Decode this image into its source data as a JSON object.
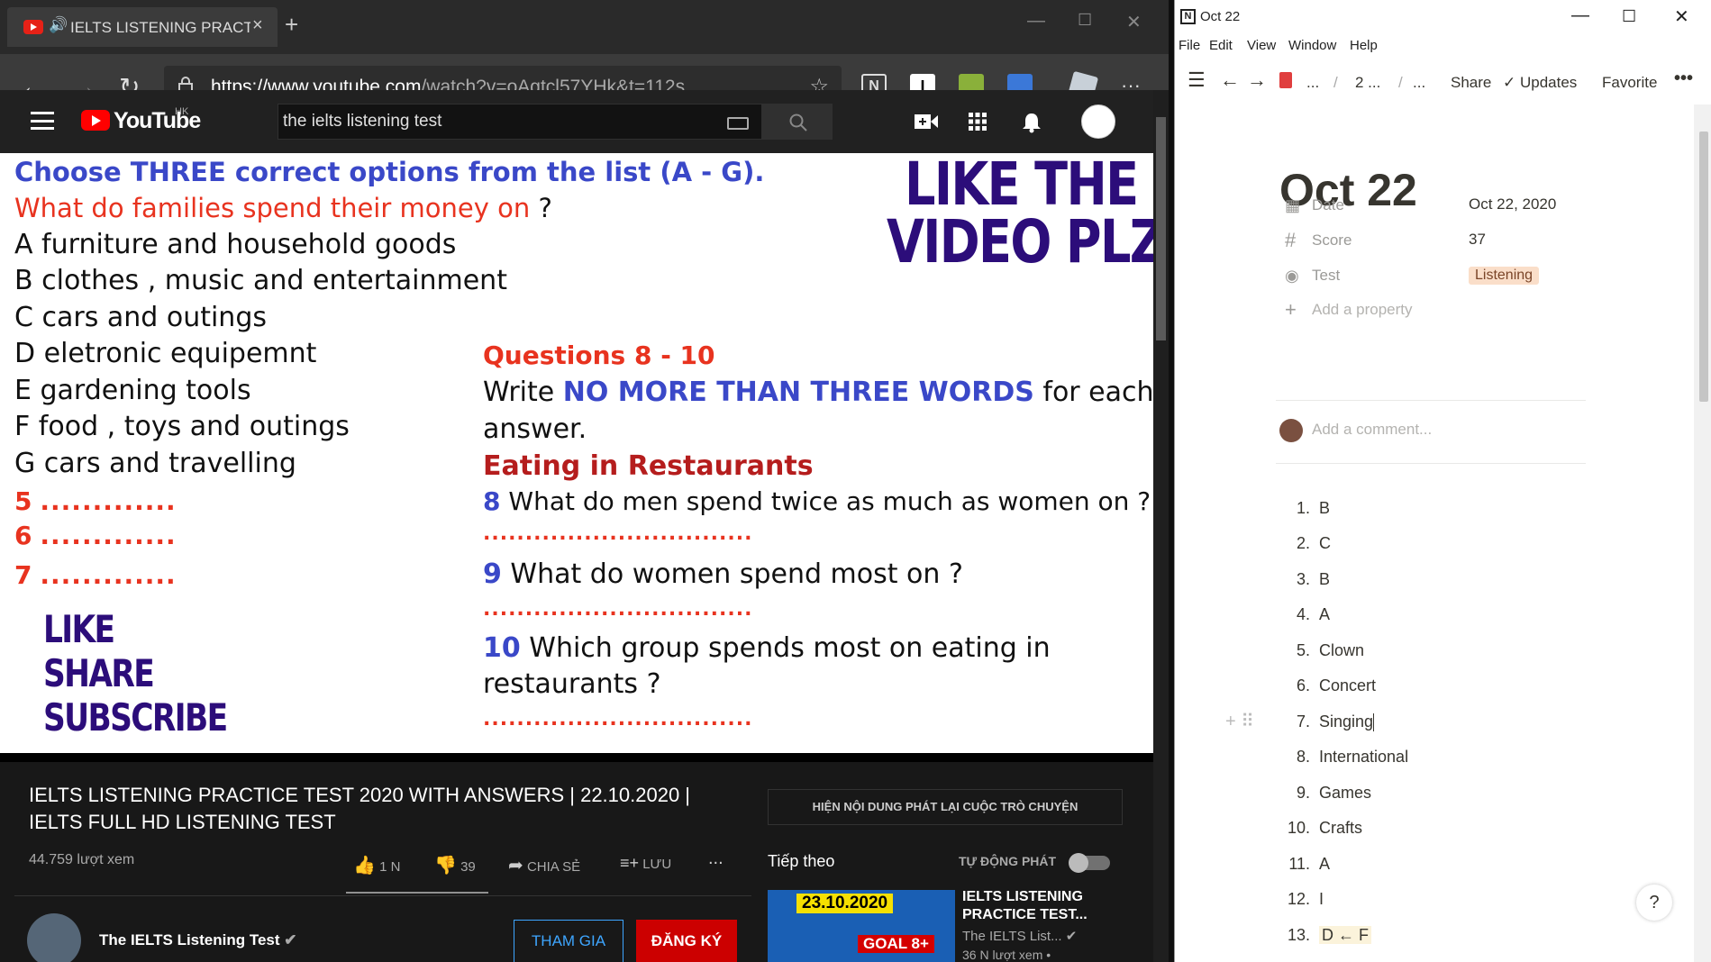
{
  "browser": {
    "tab_title": "IELTS LISTENING PRACTICE",
    "url_host": "https://www.youtube.com",
    "url_path": "/watch?v=oAgtcl57YHk&t=112s",
    "new_tab_icon": "plus-icon",
    "close_tab": "×"
  },
  "youtube": {
    "logo_text": "YouTube",
    "region": "HK",
    "search_query": "the ielts listening test"
  },
  "video": {
    "instr1": "Choose THREE correct options from the list (A - G).",
    "q_red": "What do families spend their money on",
    "q_mark": " ?",
    "options": [
      "A  furniture and household goods",
      "B  clothes , music and entertainment",
      "C  cars and outings",
      "D  eletronic equipemnt",
      "E  gardening tools",
      "F  food , toys and outings",
      "G  cars and travelling"
    ],
    "blank_labels": [
      "5",
      "6",
      "7"
    ],
    "blank_dots": ".............",
    "like_video": [
      "LIKE THE",
      "VIDEO PLZ"
    ],
    "like_share": [
      "LIKE",
      "SHARE",
      "SUBSCRIBE"
    ],
    "q_header": "Questions 8 - 10",
    "write_a": "Write ",
    "write_b": "NO MORE THAN THREE WORDS",
    "write_c": " for each",
    "write_d": "answer.",
    "eating": "Eating in Restaurants",
    "q8_num": "8",
    "q8": " What do men spend twice as much as women on ?",
    "q9_num": "9",
    "q9": "  What do women spend most on ?",
    "q10_num": "10",
    "q10a": " Which group spends most on eating in",
    "q10b": "restaurants ?",
    "long_dots": "................................"
  },
  "below": {
    "title": "IELTS LISTENING PRACTICE TEST 2020 WITH ANSWERS | 22.10.2020 | IELTS FULL HD LISTENING TEST",
    "views": "44.759 lượt xem",
    "likes": "1 N",
    "dislikes": "39",
    "share": "CHIA SẺ",
    "save": "LƯU",
    "more": "...",
    "channel": "The IELTS Listening Test",
    "join": "THAM GIA",
    "subscribe": "ĐĂNG KÝ",
    "chat_replay": "HIỆN NỘI DUNG PHÁT LẠI CUỘC TRÒ CHUYỆN",
    "up_next": "Tiếp theo",
    "autoplay": "TỰ ĐỘNG PHÁT",
    "next_title": "IELTS LISTENING PRACTICE TEST...",
    "next_channel": "The IELTS List...",
    "next_views": "36 N lượt xem •",
    "thumb_date": "23.10.2020",
    "thumb_goal": "GOAL 8+"
  },
  "notion": {
    "window_title": "Oct 22",
    "menu": [
      "File",
      "Edit",
      "View",
      "Window",
      "Help"
    ],
    "breadcrumb": [
      "...",
      "/",
      "2 ...",
      "/",
      "..."
    ],
    "share": "Share",
    "updates": "Updates",
    "favorite": "Favorite",
    "page_title": "Oct 22",
    "props": [
      {
        "icon": "calendar-icon",
        "glyph": "▦",
        "key": "Date",
        "value": "Oct 22, 2020"
      },
      {
        "icon": "hash-icon",
        "glyph": "#",
        "key": "Score",
        "value": "37"
      },
      {
        "icon": "select-icon",
        "glyph": "◉",
        "key": "Test",
        "value": "Listening"
      }
    ],
    "add_property": "Add a property",
    "comment_placeholder": "Add a comment...",
    "answers": [
      {
        "n": "1.",
        "a": "B"
      },
      {
        "n": "2.",
        "a": "C"
      },
      {
        "n": "3.",
        "a": "B"
      },
      {
        "n": "4.",
        "a": "A"
      },
      {
        "n": "5.",
        "a": "Clown"
      },
      {
        "n": "6.",
        "a": "Concert"
      },
      {
        "n": "7.",
        "a": "Singing"
      },
      {
        "n": "8.",
        "a": "International"
      },
      {
        "n": "9.",
        "a": "Games"
      },
      {
        "n": "10.",
        "a": "Crafts"
      },
      {
        "n": "11.",
        "a": "A"
      },
      {
        "n": "12.",
        "a": "I"
      },
      {
        "n": "13.",
        "a": "D ← F"
      }
    ],
    "help": "?"
  }
}
